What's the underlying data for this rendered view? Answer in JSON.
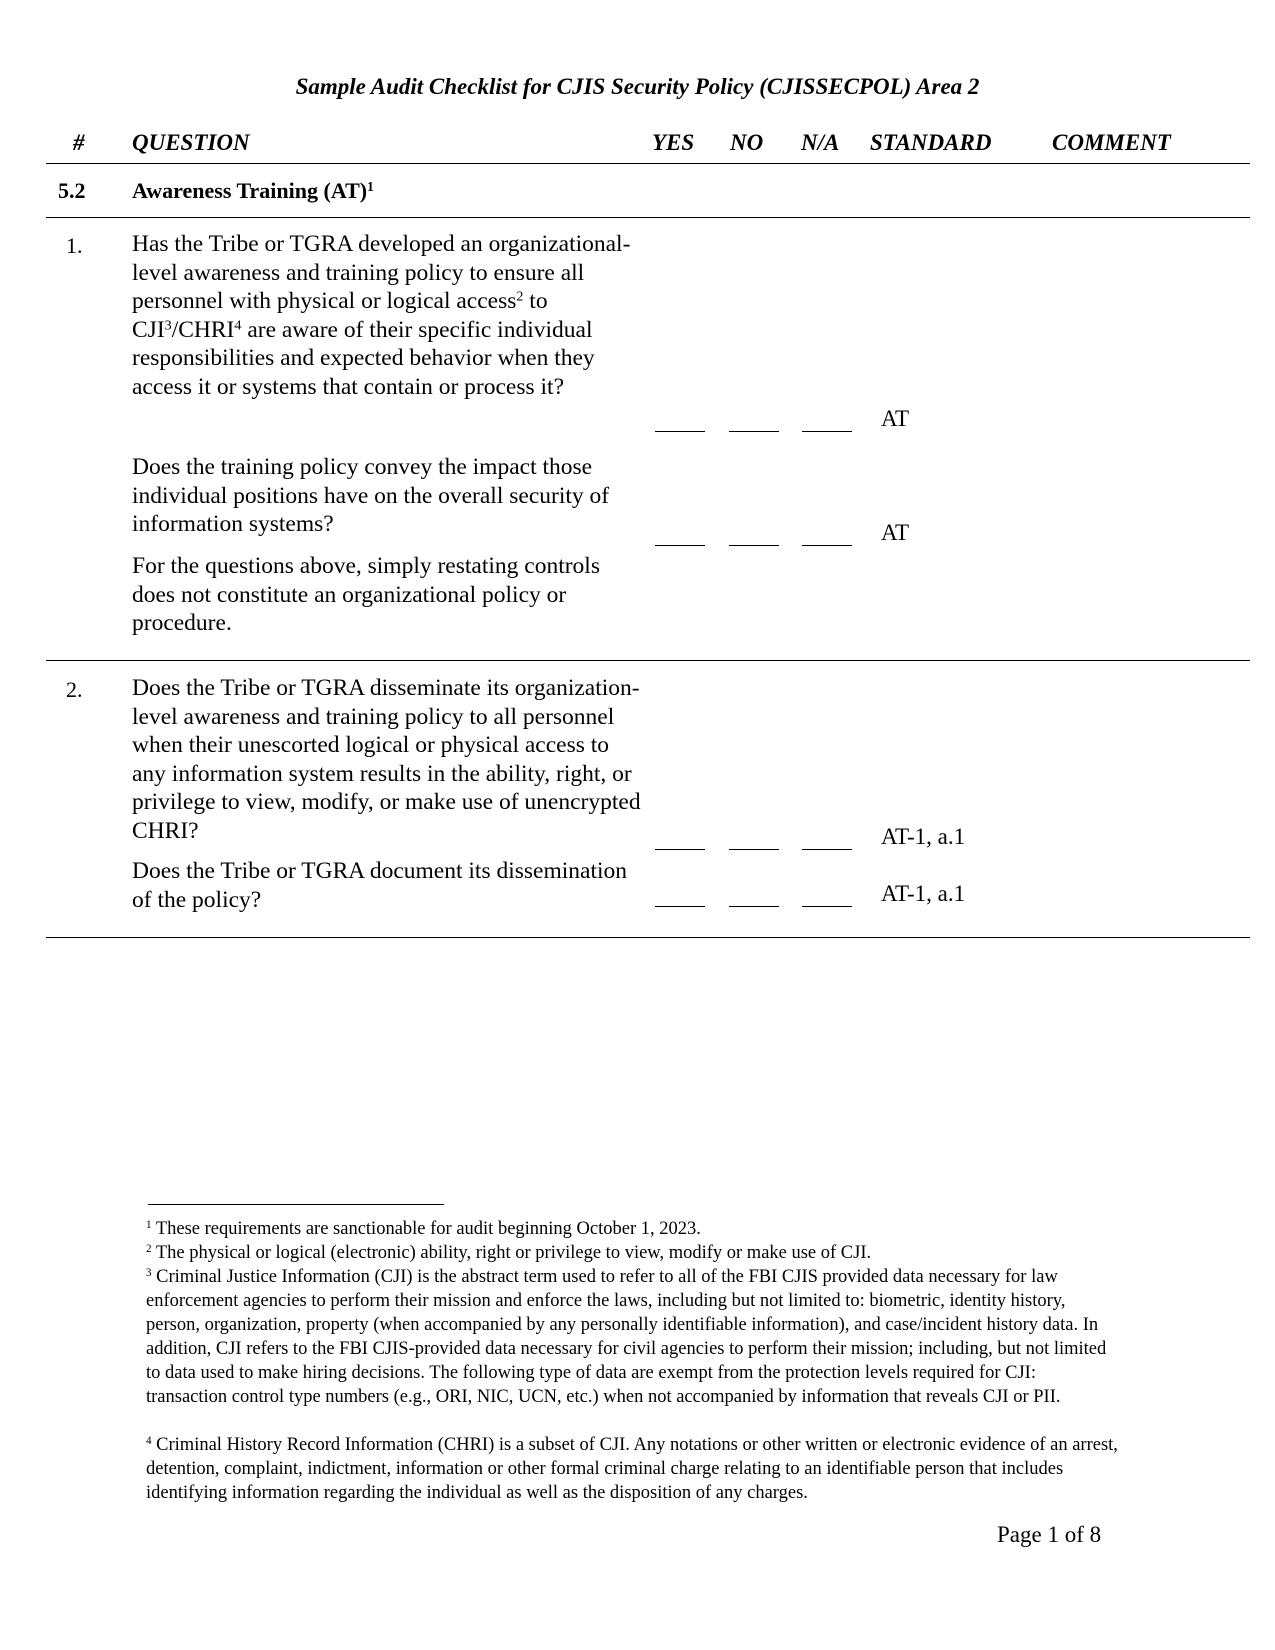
{
  "document": {
    "title": "Sample Audit Checklist for CJIS Security Policy (CJISSECPOL) Area 2",
    "columns": {
      "number": "#",
      "question": "QUESTION",
      "yes": "YES",
      "no": "NO",
      "na": "N/A",
      "standard": "STANDARD",
      "comment": "COMMENT"
    },
    "section": {
      "number": "5.2",
      "title": "Awareness Training (AT)",
      "footnote_ref": "1"
    },
    "items": [
      {
        "number": "1.",
        "q1_part1": "Has the Tribe or TGRA developed an organizational-level awareness and training policy to ensure all personnel with physical or logical access",
        "q1_sup1": "2",
        "q1_part2": " to CJI",
        "q1_sup2": "3",
        "q1_part3": "/CHRI",
        "q1_sup3": "4",
        "q1_part4": " are aware of their specific individual responsibilities and expected behavior when they access it or systems that contain or process it?",
        "q1_standard": "AT",
        "q2": "Does the training policy convey the impact those individual positions have on the overall security of information systems?",
        "q2_standard": "AT",
        "note": "For the questions above, simply restating controls does not constitute an organizational policy or procedure."
      },
      {
        "number": "2.",
        "q1": "Does the Tribe or TGRA disseminate its organization-level awareness and training policy to all personnel when their unescorted logical or physical access to any information system results in the ability, right, or privilege to view, modify, or make use of unencrypted CHRI?",
        "q1_standard": "AT-1, a.1",
        "q2": "Does the Tribe or TGRA document its dissemination of the policy?",
        "q2_standard": "AT-1, a.1"
      }
    ],
    "footnotes": [
      {
        "mark": "1",
        "text": " These requirements are sanctionable for audit beginning October 1, 2023."
      },
      {
        "mark": "2",
        "text": " The physical or logical (electronic) ability, right or privilege to view, modify or make use of CJI."
      },
      {
        "mark": "3",
        "text": " Criminal Justice Information (CJI) is the abstract term used to refer to all of the FBI CJIS provided data necessary for law enforcement agencies to perform their mission and enforce the laws, including but not limited to: biometric, identity history, person, organization, property (when accompanied by any personally identifiable information), and case/incident history data. In addition, CJI refers to the FBI CJIS-provided data necessary for civil agencies to perform their mission; including, but not limited to data used to make hiring decisions. The following type of data are exempt from the protection levels required for CJI: transaction control type numbers (e.g., ORI, NIC, UCN, etc.) when not accompanied by information that reveals CJI or PII."
      },
      {
        "mark": "4",
        "text": " Criminal History Record Information (CHRI) is a subset of CJI. Any notations or other written or electronic evidence of an arrest, detention, complaint, indictment, information or other formal criminal charge relating to an identifiable person that includes identifying information regarding the individual as well as the disposition of any charges."
      }
    ],
    "page_label": "Page 1 of 8"
  }
}
